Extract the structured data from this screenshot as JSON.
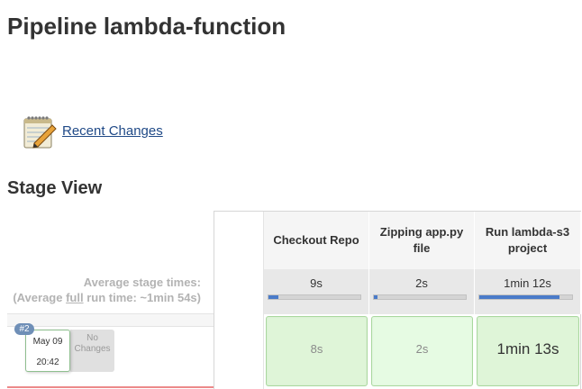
{
  "page": {
    "title": "Pipeline lambda-function"
  },
  "recent_changes": {
    "label": "Recent Changes",
    "icon": "notepad-pencil-icon"
  },
  "stage_view": {
    "title": "Stage View",
    "average_label": "Average stage times:",
    "average_full_prefix": "(Average ",
    "average_full_word": "full",
    "average_full_suffix": " run time: ~1min 54s)",
    "stages": [
      {
        "name": "Checkout Repo",
        "avg_time": "9s",
        "avg_fraction": 0.11
      },
      {
        "name": "Zipping app.py file",
        "avg_time": "2s",
        "avg_fraction": 0.03
      },
      {
        "name": "Run lambda-s3 project",
        "avg_time": "1min 12s",
        "avg_fraction": 0.86
      }
    ],
    "runs": [
      {
        "number": "#2",
        "date": "May 09",
        "time": "20:42",
        "changes": "No Changes",
        "stage_times": [
          "8s",
          "2s",
          "1min 13s"
        ]
      }
    ]
  },
  "colors": {
    "success_cell": "#dff5d8",
    "progress_fill": "#4a7bc9",
    "link": "#204a87",
    "badge": "#6f8fb7"
  }
}
